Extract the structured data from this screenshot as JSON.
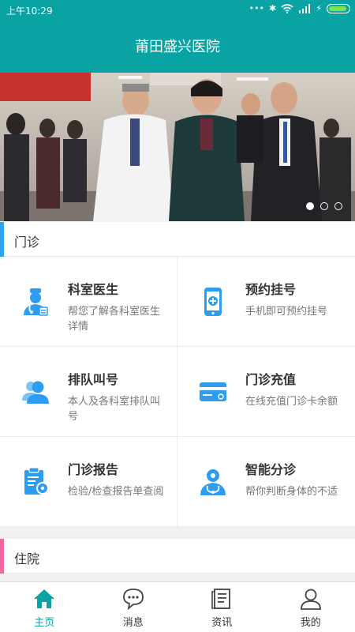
{
  "status_bar": {
    "time": "上午10:29",
    "dots": "•••",
    "bluetooth": "✱",
    "wifi": "wifi-icon",
    "signal": "signal-icon"
  },
  "header": {
    "title": "莆田盛兴医院"
  },
  "banner": {
    "slide_count": 3,
    "active_slide": 1
  },
  "sections": [
    {
      "title": "门诊",
      "accent": "#2aa6ec"
    },
    {
      "title": "住院",
      "accent": "#ef6aa4"
    }
  ],
  "outpatient": {
    "items": [
      {
        "title": "科室医生",
        "desc": "帮您了解各科室医生详情",
        "icon": "doctor-icon"
      },
      {
        "title": "预约挂号",
        "desc": "手机即可预约挂号",
        "icon": "phone-icon"
      },
      {
        "title": "排队叫号",
        "desc": "本人及各科室排队叫号",
        "icon": "users-icon"
      },
      {
        "title": "门诊充值",
        "desc": "在线充值门诊卡余额",
        "icon": "card-icon"
      },
      {
        "title": "门诊报告",
        "desc": "检验/检查报告单查阅",
        "icon": "report-icon"
      },
      {
        "title": "智能分诊",
        "desc": "帮你判断身体的不适",
        "icon": "triage-icon"
      }
    ]
  },
  "tabs": [
    {
      "label": "主页",
      "icon": "home-icon",
      "active": true
    },
    {
      "label": "消息",
      "icon": "chat-icon",
      "active": false
    },
    {
      "label": "资讯",
      "icon": "news-icon",
      "active": false
    },
    {
      "label": "我的",
      "icon": "profile-icon",
      "active": false
    }
  ],
  "colors": {
    "primary": "#0aa3a4",
    "icon_blue": "#2e9df0",
    "section_outpatient": "#2aa6ec",
    "section_inpatient": "#ef6aa4"
  }
}
